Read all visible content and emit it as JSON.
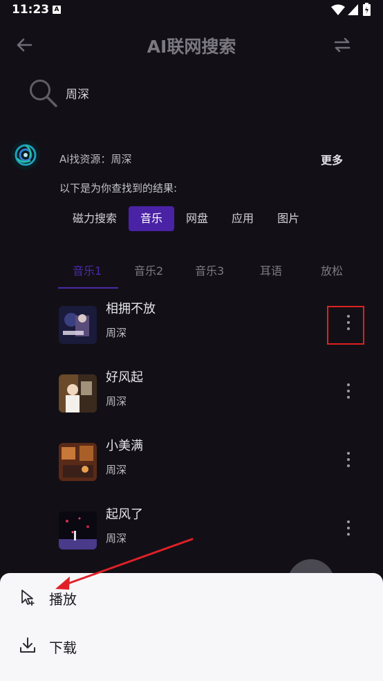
{
  "status": {
    "time": "11:23",
    "notif_icon": "A"
  },
  "header": {
    "title": "AI联网搜索"
  },
  "search": {
    "query": "周深"
  },
  "ai": {
    "label": "Ai找资源：",
    "keyword": "周深",
    "more": "更多",
    "hint": "以下是为你查找到的结果:"
  },
  "categories": [
    {
      "label": "磁力搜索",
      "active": false
    },
    {
      "label": "音乐",
      "active": true
    },
    {
      "label": "网盘",
      "active": false
    },
    {
      "label": "应用",
      "active": false
    },
    {
      "label": "图片",
      "active": false
    }
  ],
  "tabs": [
    {
      "label": "音乐1",
      "active": true
    },
    {
      "label": "音乐2",
      "active": false
    },
    {
      "label": "音乐3",
      "active": false
    },
    {
      "label": "耳语",
      "active": false
    },
    {
      "label": "放松",
      "active": false
    }
  ],
  "songs": [
    {
      "title": "相拥不放",
      "artist": "周深"
    },
    {
      "title": "好风起",
      "artist": "周深"
    },
    {
      "title": "小美满",
      "artist": "周深"
    },
    {
      "title": "起风了",
      "artist": "周深"
    }
  ],
  "sheet": {
    "play": "播放",
    "download": "下载"
  },
  "colors": {
    "accent": "#4a22a5",
    "background": "#121016",
    "sheet": "#f7f7fa",
    "highlight": "#e02020"
  }
}
